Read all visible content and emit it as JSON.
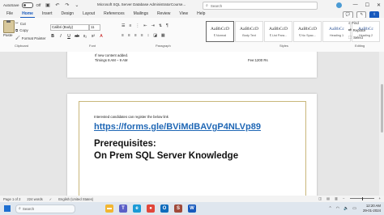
{
  "titlebar": {
    "autosave_label": "AutoSave",
    "autosave_state": "Off",
    "doc_title": "Microsoft SQL Server Database AdministratorCourse... ",
    "search_placeholder": "Search"
  },
  "tabs": [
    "File",
    "Home",
    "Insert",
    "Design",
    "Layout",
    "References",
    "Mailings",
    "Review",
    "View",
    "Help"
  ],
  "ribbon": {
    "paste": "Paste",
    "cut": "Cut",
    "copy": "Copy",
    "format_painter": "Format Painter",
    "clipboard_label": "Clipboard",
    "font_name": "Calibri (Body)",
    "font_size": "11",
    "font_label": "Font",
    "paragraph_label": "Paragraph",
    "styles_label": "Styles",
    "styles": [
      {
        "sample": "AaBbCcD",
        "name": "¶ Normal",
        "blue": false
      },
      {
        "sample": "AaBbCcD",
        "name": "Body Text",
        "blue": false
      },
      {
        "sample": "AaBbCcD",
        "name": "¶ List Para...",
        "blue": false
      },
      {
        "sample": "AaBbCcD",
        "name": "¶ No Spac...",
        "blue": false
      },
      {
        "sample": "AaBbCc",
        "name": "Heading 1",
        "blue": true
      },
      {
        "sample": "AaBbCc",
        "name": "Heading 2",
        "blue": true
      }
    ],
    "find": "Find",
    "replace": "Replace",
    "select": "Select",
    "editing_label": "Editing"
  },
  "document": {
    "page1_line1": "If new content added.",
    "page1_line2": "Timings 8 AM – 9 AM",
    "page1_fee": "Fee:1200 Rs",
    "register_text": "Interested candidates can register the below link",
    "link": "https://forms.gle/BViMdBAVgP4NLVp89",
    "heading1": "Prerequisites:",
    "heading2": "On Prem SQL Server Knowledge"
  },
  "statusbar": {
    "page": "Page 1 of 2",
    "words": "224 words",
    "language": "English (United States)"
  },
  "taskbar": {
    "search_placeholder": "Search",
    "apps": [
      {
        "icon": "file-explorer-icon",
        "color": "#f2b632",
        "glyph": "▬"
      },
      {
        "icon": "teams-icon",
        "color": "#5b5fc7",
        "glyph": "T"
      },
      {
        "icon": "edge-icon",
        "color": "#1a9ad6",
        "glyph": "e"
      },
      {
        "icon": "chrome-icon",
        "color": "#e1463a",
        "glyph": "●"
      },
      {
        "icon": "outlook-icon",
        "color": "#0f6cbd",
        "glyph": "O"
      },
      {
        "icon": "ssms-icon",
        "color": "#a04a3a",
        "glyph": "S"
      },
      {
        "icon": "word-icon",
        "color": "#185abd",
        "glyph": "W"
      }
    ],
    "time": "12:20 AM",
    "date": "29-01-2024"
  }
}
